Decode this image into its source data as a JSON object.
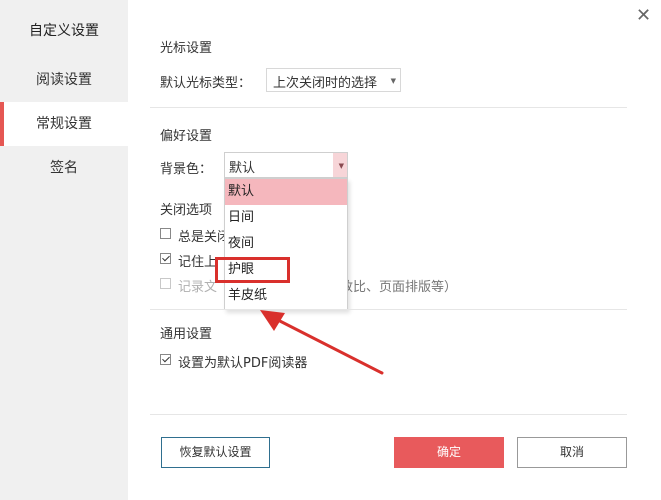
{
  "sidebar": {
    "title": "自定义设置",
    "items": [
      {
        "label": "阅读设置"
      },
      {
        "label": "常规设置",
        "active": true
      },
      {
        "label": "签名"
      }
    ]
  },
  "cursor": {
    "section_title": "光标设置",
    "type_label": "默认光标类型：",
    "type_value": "上次关闭时的选择"
  },
  "preference": {
    "section_title": "偏好设置",
    "bg_label": "背景色：",
    "bg_value": "默认",
    "options": [
      "默认",
      "日间",
      "夜间",
      "护眼",
      "羊皮纸"
    ],
    "selected_option": "默认",
    "highlighted_option": "护眼"
  },
  "close_options": {
    "section_title": "关闭选项",
    "items": [
      {
        "label": "总是关闭",
        "checked": false
      },
      {
        "label": "记住上",
        "checked": true
      },
      {
        "label": "记录文",
        "suffix": "放比、页面排版等）",
        "checked": false,
        "disabled": true
      }
    ]
  },
  "general": {
    "section_title": "通用设置",
    "default_pdf_label": "设置为默认PDF阅读器",
    "default_pdf_checked": true
  },
  "footer": {
    "restore_label": "恢复默认设置",
    "ok_label": "确定",
    "cancel_label": "取消"
  },
  "colors": {
    "accent": "#e85a5c",
    "selected_option_bg": "#f5b7bd",
    "highlight_box": "#d9302c",
    "arrow": "#d9302c"
  }
}
